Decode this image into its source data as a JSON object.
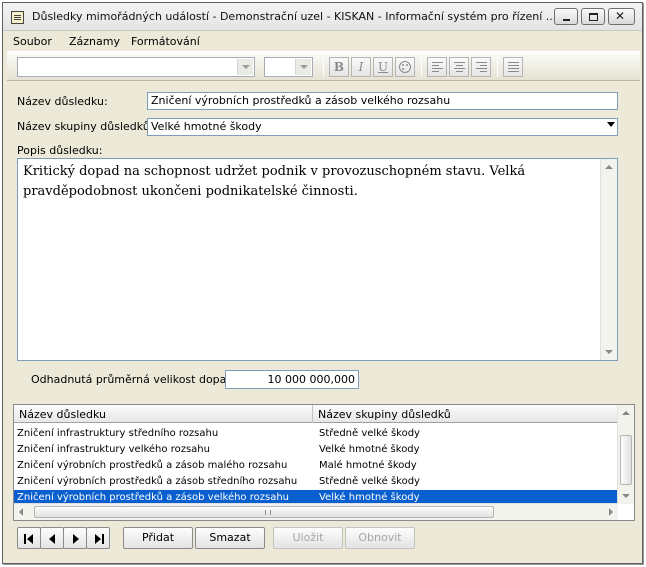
{
  "window": {
    "title": "Důsledky mimořádných událostí - Demonstrační uzel - KISKAN - Informační systém pro řízení ..."
  },
  "menu": [
    "Soubor",
    "Záznamy",
    "Formátování"
  ],
  "toolbar": {
    "font_name": "",
    "font_size": "",
    "bold": "B",
    "italic": "I",
    "underline": "U"
  },
  "form": {
    "name_label": "Název důsledku:",
    "name_value": "Zničení výrobních prostředků a zásob velkého rozsahu",
    "group_label": "Název skupiny důsledků:",
    "group_value": "Velké hmotné škody",
    "desc_label": "Popis důsledku:",
    "desc_value": "Kritický dopad na schopnost udržet podnik v provozuschopném stavu. Velká pravděpodobnost ukončeni podnikatelské činnosti.",
    "estimate_label": "Odhadnutá průměrná velikost dopadu:",
    "estimate_value": "10 000 000,000"
  },
  "grid": {
    "columns": [
      "Název důsledku",
      "Název skupiny důsledků"
    ],
    "rows": [
      [
        "Zničení infrastruktury středního rozsahu",
        "Středně velké škody"
      ],
      [
        "Zničení infrastruktury velkého rozsahu",
        "Velké hmotné škody"
      ],
      [
        "Zničení výrobních prostředků a zásob malého rozsahu",
        "Malé hmotné škody"
      ],
      [
        "Zničení výrobních prostředků a zásob středního rozsahu",
        "Středně velké škody"
      ],
      [
        "Zničení výrobních prostředků a zásob velkého rozsahu",
        "Velké hmotné škody"
      ]
    ],
    "selected_row": 4,
    "selected_color": "#0a5fcf"
  },
  "buttons": {
    "add": "Přidat",
    "delete": "Smazat",
    "save": "Uložit",
    "refresh": "Obnovit"
  }
}
